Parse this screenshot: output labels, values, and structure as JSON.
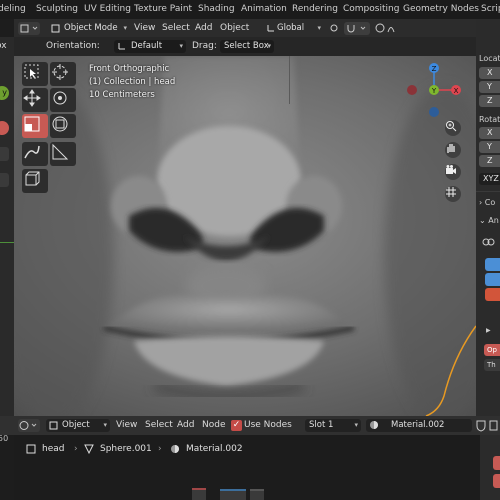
{
  "workspace_tabs": [
    "deling",
    "Sculpting",
    "UV Editing",
    "Texture Paint",
    "Shading",
    "Animation",
    "Rendering",
    "Compositing",
    "Geometry Nodes",
    "Scrip"
  ],
  "viewport_header": {
    "editor_icon": "cube-icon",
    "mode": "Object Mode",
    "menus": [
      "View",
      "Select",
      "Add",
      "Object"
    ],
    "transform_orientation": "Global"
  },
  "tool_header": {
    "orientation_label": "Orientation:",
    "orientation_value": "Default",
    "drag_label": "Drag:",
    "drag_value": "Select Box"
  },
  "left_strip": {
    "cut_label": "ox",
    "axis_marker": "y"
  },
  "viewport": {
    "info_lines": [
      "Front Orthographic",
      "(1) Collection | head",
      "10 Centimeters"
    ]
  },
  "gizmo": {
    "x_label": "X",
    "y_label": "Y",
    "z_label": "Z",
    "colors": {
      "x": "#e0454f",
      "y": "#7fb72e",
      "z": "#3d8ae0"
    }
  },
  "right_panel": {
    "location_label": "Locati",
    "location_axes": [
      "X",
      "Y",
      "Z"
    ],
    "rotation_label": "Rotati",
    "rotation_axes": [
      "X",
      "Y",
      "Z"
    ],
    "rotation_mode": "XYZ",
    "collapsed_section": "Co",
    "open_section": "An",
    "op_label": "Op",
    "th_label": "Th"
  },
  "node_header": {
    "editor_type": "Object",
    "menus": [
      "View",
      "Select",
      "Add",
      "Node"
    ],
    "use_nodes_label": "Use Nodes",
    "use_nodes_checked": true,
    "slot": "Slot 1",
    "material": "Material.002",
    "left_number": "50"
  },
  "breadcrumb": {
    "object": "head",
    "mesh": "Sphere.001",
    "material": "Material.002"
  },
  "colors": {
    "accent_active": "#c75a54",
    "checkbox": "#c44b47",
    "orange_curve": "#e89a22"
  }
}
